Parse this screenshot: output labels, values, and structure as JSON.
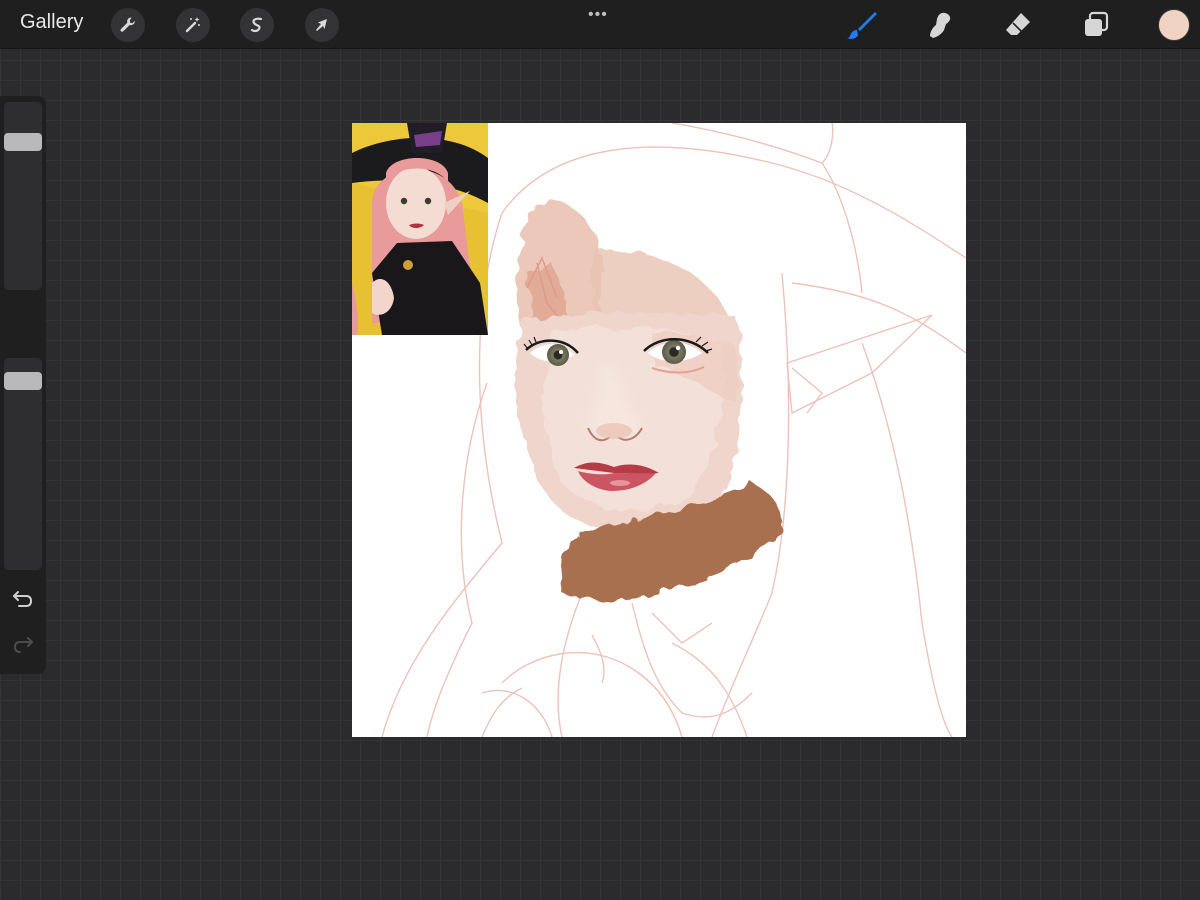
{
  "topbar": {
    "gallery_label": "Gallery",
    "left_tools": [
      "wrench-icon",
      "magic-wand-icon",
      "selection-icon",
      "transform-arrow-icon"
    ],
    "more_menu": "•••",
    "right_tools": [
      "brush-icon",
      "smudge-icon",
      "eraser-icon",
      "layers-icon"
    ],
    "active_tool": "brush",
    "current_color": "#f1d3c4"
  },
  "sidebar": {
    "brush_size_level": 0.82,
    "opacity_level": 0.93,
    "controls": [
      "brush-size-slider",
      "modify-square-icon",
      "opacity-slider",
      "undo-icon",
      "redo-icon"
    ]
  },
  "colors": {
    "accent": "#1f7cf2",
    "canvas": "#ffffff",
    "sketch_line": "#eab8b0",
    "skin": "#f0d6cd",
    "hair": "#e6b49e",
    "collar": "#a9704f",
    "lips": "#c9424e"
  }
}
